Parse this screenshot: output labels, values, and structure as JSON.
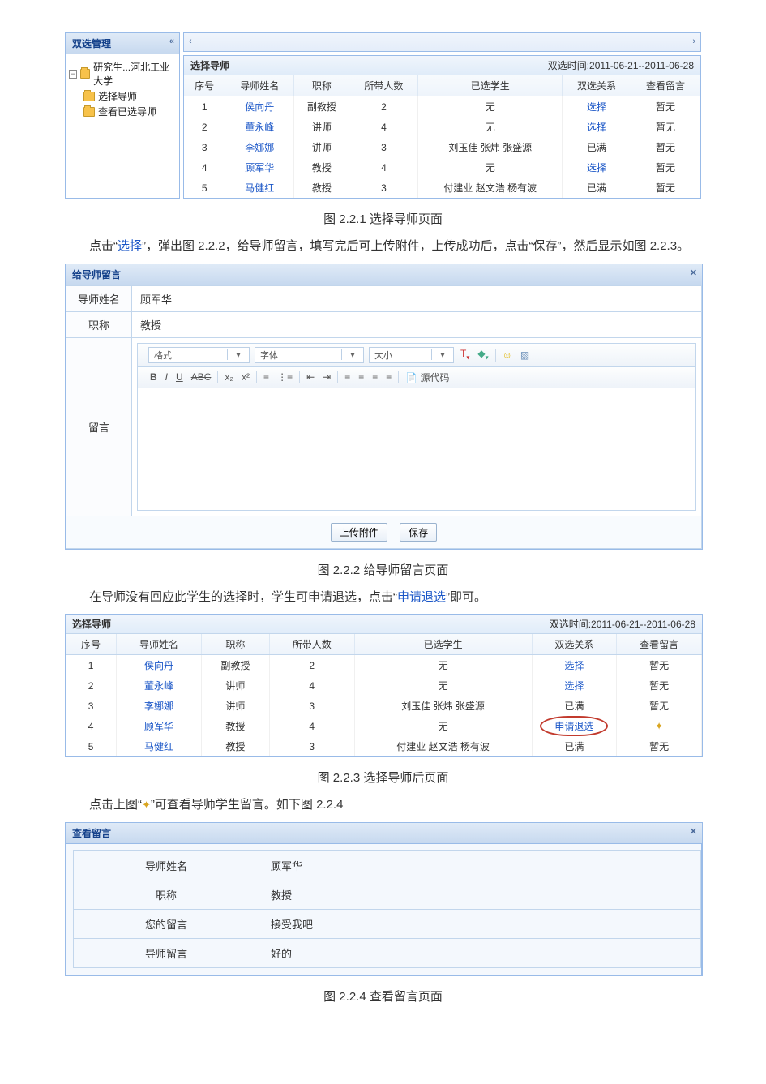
{
  "fig1": {
    "sidebar": {
      "header": "双选管理",
      "nodes": [
        {
          "label": "研究生...河北工业大学",
          "level": 0,
          "expand": true
        },
        {
          "label": "选择导师",
          "level": 1
        },
        {
          "label": "查看已选导师",
          "level": 1
        }
      ]
    },
    "table": {
      "title": "选择导师",
      "when": "双选时间:2011-06-21--2011-06-28",
      "columns": [
        "序号",
        "导师姓名",
        "职称",
        "所带人数",
        "已选学生",
        "双选关系",
        "查看留言"
      ],
      "rows": [
        {
          "no": "1",
          "name": "侯向丹",
          "title": "副教授",
          "count": "2",
          "students": "无",
          "rel": "选择",
          "rel_link": true,
          "msg": "暂无"
        },
        {
          "no": "2",
          "name": "董永峰",
          "title": "讲师",
          "count": "4",
          "students": "无",
          "rel": "选择",
          "rel_link": true,
          "msg": "暂无"
        },
        {
          "no": "3",
          "name": "李娜娜",
          "title": "讲师",
          "count": "3",
          "students": "刘玉佳 张炜 张盛源",
          "rel": "已满",
          "rel_link": false,
          "msg": "暂无"
        },
        {
          "no": "4",
          "name": "顾军华",
          "title": "教授",
          "count": "4",
          "students": "无",
          "rel": "选择",
          "rel_link": true,
          "msg": "暂无"
        },
        {
          "no": "5",
          "name": "马健红",
          "title": "教授",
          "count": "3",
          "students": "付建业 赵文浩 杨有波",
          "rel": "已满",
          "rel_link": false,
          "msg": "暂无"
        }
      ]
    }
  },
  "captions": {
    "c1": "图 2.2.1  选择导师页面",
    "c2": "图 2.2.2  给导师留言页面",
    "c3": "图 2.2.3  选择导师后页面",
    "c4": "图 2.2.4  查看留言页面"
  },
  "texts": {
    "p1a": "点击“",
    "p1link": "选择",
    "p1b": "”，弹出图 2.2.2，给导师留言，填写完后可上传附件，上传成功后，点击“保存”，然后显示如图 2.2.3。",
    "p2a": "在导师没有回应此学生的选择时，学生可申请退选，点击“",
    "p2link": "申请退选",
    "p2b": "”即可。",
    "p3": "点击上图“",
    "p3icon": "✦",
    "p3b": "”可查看导师学生留言。如下图 2.2.4"
  },
  "fig2": {
    "title": "给导师留言",
    "name_label": "导师姓名",
    "name_value": "顾军华",
    "title_label": "职称",
    "title_value": "教授",
    "msg_label": "留言",
    "toolbar": {
      "format": "格式",
      "font": "字体",
      "size": "大小",
      "source": "源代码"
    },
    "btn_upload": "上传附件",
    "btn_save": "保存"
  },
  "fig3": {
    "title": "选择导师",
    "when": "双选时间:2011-06-21--2011-06-28",
    "columns": [
      "序号",
      "导师姓名",
      "职称",
      "所带人数",
      "已选学生",
      "双选关系",
      "查看留言"
    ],
    "rows": [
      {
        "no": "1",
        "name": "侯向丹",
        "title": "副教授",
        "count": "2",
        "students": "无",
        "rel": "选择",
        "rel_link": true,
        "msg": "暂无",
        "msg_icon": false,
        "circle": false
      },
      {
        "no": "2",
        "name": "董永峰",
        "title": "讲师",
        "count": "4",
        "students": "无",
        "rel": "选择",
        "rel_link": true,
        "msg": "暂无",
        "msg_icon": false,
        "circle": false
      },
      {
        "no": "3",
        "name": "李娜娜",
        "title": "讲师",
        "count": "3",
        "students": "刘玉佳 张炜 张盛源",
        "rel": "已满",
        "rel_link": false,
        "msg": "暂无",
        "msg_icon": false,
        "circle": false
      },
      {
        "no": "4",
        "name": "顾军华",
        "title": "教授",
        "count": "4",
        "students": "无",
        "rel": "申请退选",
        "rel_link": true,
        "msg": "",
        "msg_icon": true,
        "circle": true
      },
      {
        "no": "5",
        "name": "马健红",
        "title": "教授",
        "count": "3",
        "students": "付建业 赵文浩 杨有波",
        "rel": "已满",
        "rel_link": false,
        "msg": "暂无",
        "msg_icon": false,
        "circle": false
      }
    ]
  },
  "fig4": {
    "title": "查看留言",
    "rows": [
      {
        "label": "导师姓名",
        "value": "顾军华"
      },
      {
        "label": "职称",
        "value": "教授"
      },
      {
        "label": "您的留言",
        "value": "接受我吧"
      },
      {
        "label": "导师留言",
        "value": "好的"
      }
    ]
  }
}
